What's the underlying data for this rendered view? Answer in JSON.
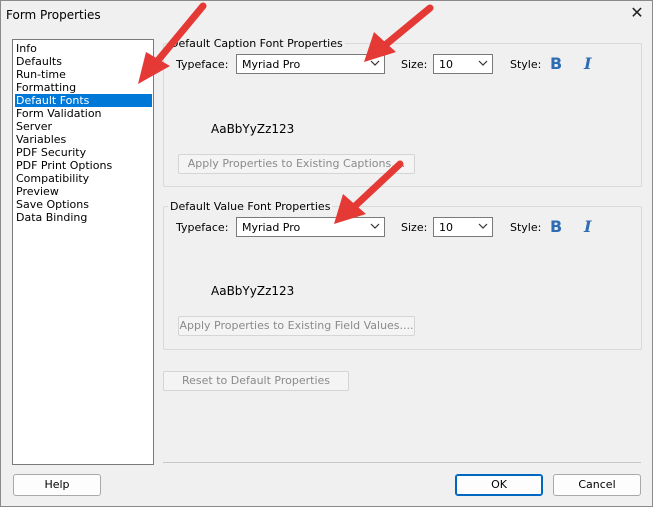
{
  "window": {
    "title": "Form Properties"
  },
  "sidebar": {
    "items": [
      {
        "label": "Info",
        "selected": false
      },
      {
        "label": "Defaults",
        "selected": false
      },
      {
        "label": "Run-time",
        "selected": false
      },
      {
        "label": "Formatting",
        "selected": false
      },
      {
        "label": "Default Fonts",
        "selected": true
      },
      {
        "label": "Form Validation",
        "selected": false
      },
      {
        "label": "Server",
        "selected": false
      },
      {
        "label": "Variables",
        "selected": false
      },
      {
        "label": "PDF Security",
        "selected": false
      },
      {
        "label": "PDF Print Options",
        "selected": false
      },
      {
        "label": "Compatibility",
        "selected": false
      },
      {
        "label": "Preview",
        "selected": false
      },
      {
        "label": "Save Options",
        "selected": false
      },
      {
        "label": "Data Binding",
        "selected": false
      }
    ]
  },
  "caption_group": {
    "title": "Default Caption Font Properties",
    "typeface_label": "Typeface:",
    "typeface_value": "Myriad Pro",
    "size_label": "Size:",
    "size_value": "10",
    "style_label": "Style:",
    "bold_glyph": "B",
    "italic_glyph": "I",
    "sample": "AaBbYyZz123",
    "apply_button": "Apply Properties to Existing Captions...."
  },
  "value_group": {
    "title": "Default Value Font Properties",
    "typeface_label": "Typeface:",
    "typeface_value": "Myriad Pro",
    "size_label": "Size:",
    "size_value": "10",
    "style_label": "Style:",
    "bold_glyph": "B",
    "italic_glyph": "I",
    "sample": "AaBbYyZz123",
    "apply_button": "Apply Properties to Existing Field Values...."
  },
  "reset_button": "Reset to Default Properties",
  "footer": {
    "help": "Help",
    "ok": "OK",
    "cancel": "Cancel"
  },
  "colors": {
    "selection": "#0078d7",
    "style_icons": "#2e6db4",
    "annotation_arrows": "#e53935"
  }
}
